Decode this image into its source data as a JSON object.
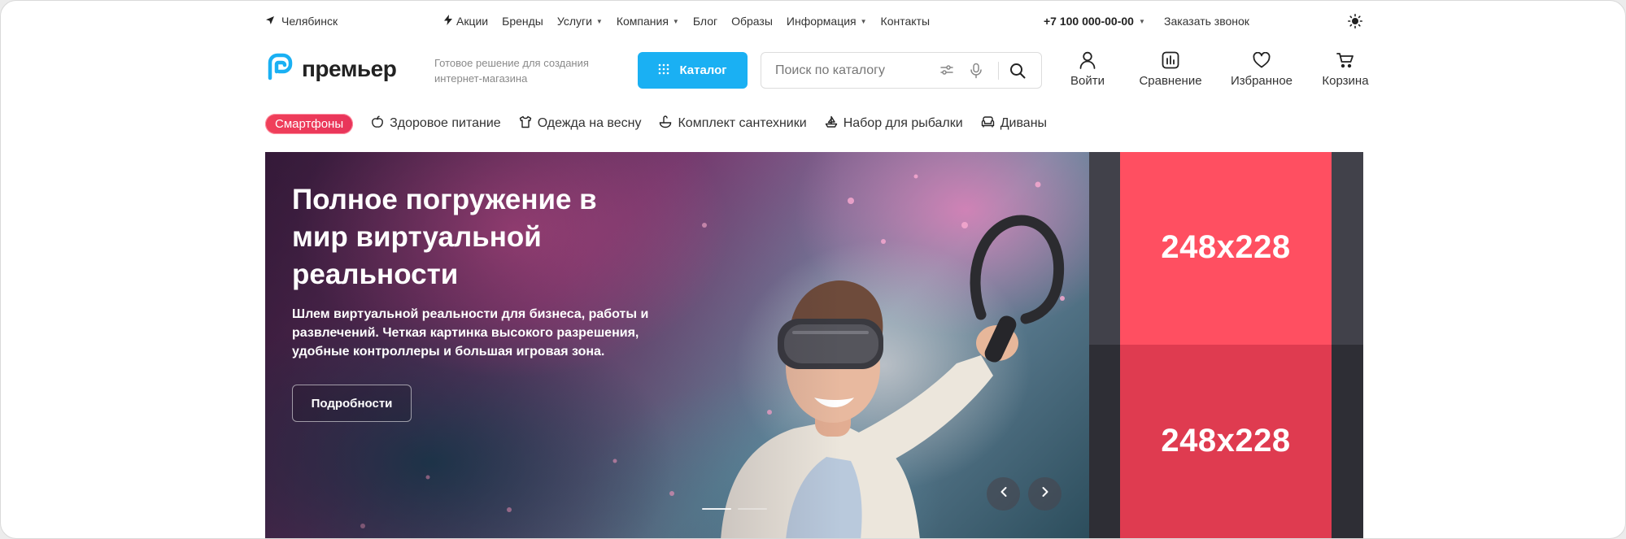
{
  "topbar": {
    "city": "Челябинск",
    "nav": [
      {
        "label": "Акции",
        "icon": "bolt-icon",
        "dropdown": false
      },
      {
        "label": "Бренды",
        "dropdown": false
      },
      {
        "label": "Услуги",
        "dropdown": true
      },
      {
        "label": "Компания",
        "dropdown": true
      },
      {
        "label": "Блог",
        "dropdown": false
      },
      {
        "label": "Образы",
        "dropdown": false
      },
      {
        "label": "Информация",
        "dropdown": true
      },
      {
        "label": "Контакты",
        "dropdown": false
      }
    ],
    "phone": "+7 100 000-00-00",
    "callback": "Заказать звонок",
    "theme_icon": "sun-icon"
  },
  "header": {
    "logo_text": "премьер",
    "tagline": "Готовое решение для создания интернет-магазина",
    "catalog_label": "Каталог",
    "search_placeholder": "Поиск по каталогу",
    "actions": [
      {
        "label": "Войти",
        "icon": "user-icon"
      },
      {
        "label": "Сравнение",
        "icon": "compare-icon"
      },
      {
        "label": "Избранное",
        "icon": "heart-icon"
      },
      {
        "label": "Корзина",
        "icon": "cart-icon"
      }
    ]
  },
  "chips": [
    {
      "label": "Смартфоны",
      "hot": true
    },
    {
      "label": "Здоровое питание",
      "icon": "apple-icon"
    },
    {
      "label": "Одежда на весну",
      "icon": "shirt-icon"
    },
    {
      "label": "Комплект сантехники",
      "icon": "sink-icon"
    },
    {
      "label": "Набор для рыбалки",
      "icon": "boat-icon"
    },
    {
      "label": "Диваны",
      "icon": "sofa-icon"
    }
  ],
  "hero": {
    "title": "Полное погружение в мир виртуальной реальности",
    "text": "Шлем виртуальной реальности для бизнеса, работы и развлечений. Четкая картинка высокого разрешения, удобные контроллеры и большая игровая зона.",
    "button": "Подробности",
    "slides_total": 2,
    "active_slide": 1
  },
  "side_banners": [
    {
      "label": "248x228",
      "color": "#ff4f61"
    },
    {
      "label": "248x228",
      "color": "#df3b50"
    }
  ],
  "colors": {
    "accent": "#1ab0f3",
    "hot_chip": "#f0405a"
  }
}
